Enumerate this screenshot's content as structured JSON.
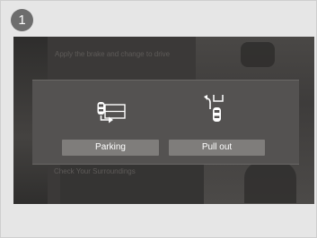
{
  "step": {
    "number": "1"
  },
  "screen": {
    "hint_top": "Apply the brake and change to drive",
    "hint_bottom": "Check Your Surroundings"
  },
  "panel": {
    "options": [
      {
        "label": "Parking",
        "icon": "parking-mode-icon"
      },
      {
        "label": "Pull out",
        "icon": "pull-out-mode-icon"
      }
    ]
  },
  "colors": {
    "screen_bg": "#3b3938",
    "panel_bg": "#545251",
    "button_bg": "#7f7d7b",
    "badge_bg": "#6d6d6d",
    "page_bg": "#e6e6e6"
  }
}
